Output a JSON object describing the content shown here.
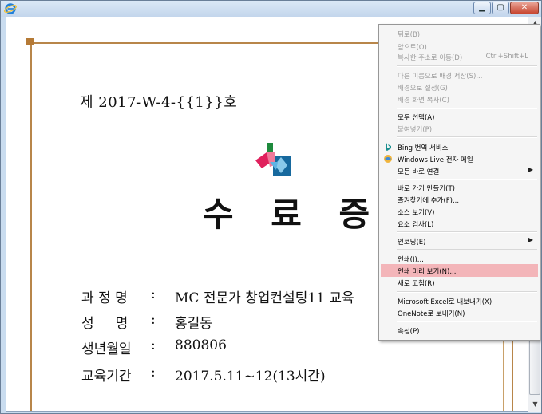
{
  "certificate": {
    "number": "제 2017-W-4-{{1}}호",
    "title": "수 료 증",
    "fields": [
      {
        "label": "과 정 명",
        "value": "MC 전문가 창업컨설팅11 교육"
      },
      {
        "label": "성     명",
        "value": "홍길동"
      },
      {
        "label": "생년월일",
        "value": "880806"
      },
      {
        "label": "교육기간",
        "value": "2017.5.11~12(13시간)"
      }
    ],
    "colon": ":"
  },
  "context_menu": {
    "items": [
      {
        "label": "뒤로(B)",
        "disabled": true
      },
      {
        "label": "앞으로(O)",
        "disabled": true
      },
      {
        "label": "복사한 주소로 이동(D)",
        "shortcut": "Ctrl+Shift+L",
        "disabled": true
      },
      {
        "label": "다른 이름으로 배경 저장(S)...",
        "disabled": true
      },
      {
        "label": "배경으로 설정(G)",
        "disabled": true
      },
      {
        "label": "배경 화면 복사(C)",
        "disabled": true
      },
      {
        "label": "모두 선택(A)",
        "disabled": false
      },
      {
        "label": "붙여넣기(P)",
        "disabled": true
      },
      {
        "label": "Bing 번역 서비스",
        "icon": "bing-icon"
      },
      {
        "label": "Windows Live 전자 메일",
        "icon": "windows-live-mail-icon"
      },
      {
        "label": "모든 바로 연결",
        "submenu": true
      },
      {
        "label": "바로 가기 만들기(T)"
      },
      {
        "label": "즐겨찾기에 추가(F)..."
      },
      {
        "label": "소스 보기(V)"
      },
      {
        "label": "요소 검사(L)"
      },
      {
        "label": "인코딩(E)",
        "submenu": true
      },
      {
        "label": "인쇄(I)..."
      },
      {
        "label": "인쇄 미리 보기(N)...",
        "highlighted": true
      },
      {
        "label": "새로 고침(R)"
      },
      {
        "label": "Microsoft Excel로 내보내기(X)"
      },
      {
        "label": "OneNote로 보내기(N)"
      },
      {
        "label": "속성(P)"
      }
    ]
  },
  "colors": {
    "border_gold": "#b8864a",
    "menu_highlight": "#f3b5b9",
    "titlebar": "#c9dcef"
  }
}
